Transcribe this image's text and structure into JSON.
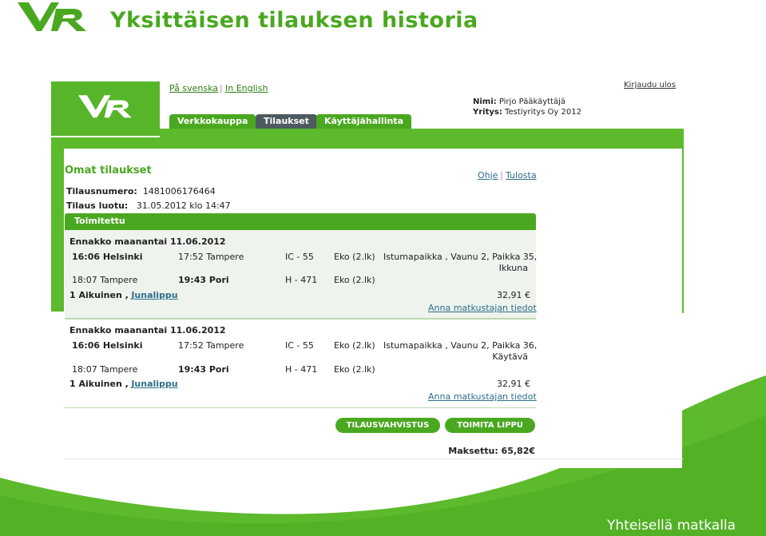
{
  "slide": {
    "title": "Yksittäisen tilauksen historia",
    "slogan": "Yhteisellä matkalla",
    "colors": {
      "brand_green": "#4aa820",
      "light_green": "#5dba2c",
      "wave_green": "#57b52a"
    }
  },
  "header": {
    "lang_sv": "På svenska",
    "lang_en": "In English",
    "logout": "Kirjaudu ulos",
    "name_label": "Nimi:",
    "name_value": "Pirjo Pääkäyttäjä",
    "company_label": "Yritys:",
    "company_value": "Testiyritys Oy 2012",
    "tabs": [
      "Verkkokauppa",
      "Tilaukset",
      "Käyttäjähallinta"
    ]
  },
  "content": {
    "heading": "Omat tilaukset",
    "help": "Ohje",
    "print": "Tulosta",
    "order_number_label": "Tilausnumero:",
    "order_number": "1481006176464",
    "created_label": "Tilaus luotu:",
    "created": "31.05.2012 klo 14:47",
    "status": "Toimitettu",
    "trips": [
      {
        "title": "Ennakko maanantai 11.06.2012",
        "legs": [
          {
            "dep": "16:06 Helsinki",
            "arr": "17:52 Tampere",
            "train": "IC - 55",
            "class": "Eko (2.lk)",
            "seat": "Istumapaikka , Vaunu 2, Paikka 35,",
            "seat2": "Ikkuna"
          },
          {
            "dep": "18:07 Tampere",
            "arr": "19:43 Pori",
            "train": "H - 471",
            "class": "Eko (2.lk)",
            "seat": "",
            "seat2": ""
          }
        ],
        "passenger": "1 Aikuinen ,",
        "ticket": "Junalippu",
        "price": "32,91 €",
        "traveller_link": "Anna matkustajan tiedot"
      },
      {
        "title": "Ennakko maanantai 11.06.2012",
        "legs": [
          {
            "dep": "16:06 Helsinki",
            "arr": "17:52 Tampere",
            "train": "IC - 55",
            "class": "Eko (2.lk)",
            "seat": "Istumapaikka , Vaunu 2, Paikka 36,",
            "seat2": "Käytävä"
          },
          {
            "dep": "18:07 Tampere",
            "arr": "19:43 Pori",
            "train": "H - 471",
            "class": "Eko (2.lk)",
            "seat": "",
            "seat2": ""
          }
        ],
        "passenger": "1 Aikuinen ,",
        "ticket": "Junalippu",
        "price": "32,91 €",
        "traveller_link": "Anna matkustajan tiedot"
      }
    ],
    "btn_confirm": "TILAUSVAHVISTUS",
    "btn_deliver": "TOIMITA LIPPU",
    "paid": "Maksettu: 65,82€"
  }
}
